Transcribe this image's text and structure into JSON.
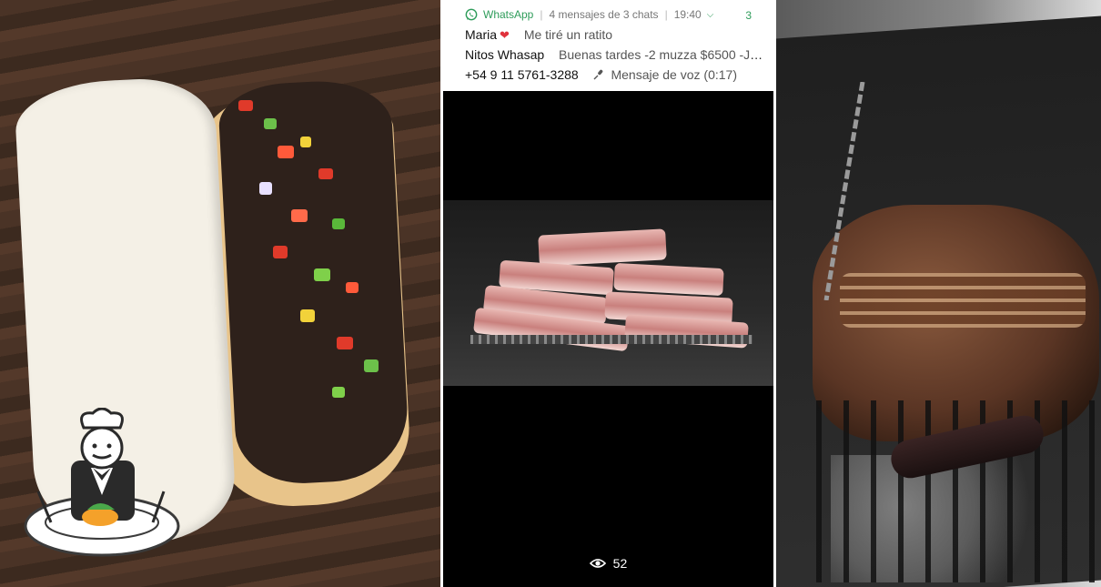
{
  "notification": {
    "app_name": "WhatsApp",
    "summary": "4 mensajes de 3 chats",
    "time": "19:40",
    "badge_count": "3",
    "messages": [
      {
        "sender": "Maria",
        "text": "Me tiré un ratito"
      },
      {
        "sender": "Nitos Whasap",
        "text": "Buenas tardes  -2 muzza $6500 -Jamo…"
      },
      {
        "sender": "+54 9 11 5761-3288",
        "text": "Mensaje de voz (0:17)"
      }
    ]
  },
  "status": {
    "view_count": "52"
  },
  "colors": {
    "whatsapp_green": "#2e9c5a",
    "heart_red": "#e0323c"
  },
  "icons": {
    "whatsapp": "whatsapp-icon",
    "heart": "heart-icon",
    "mic": "microphone-icon",
    "chevron": "chevron-down-icon",
    "eye": "eye-icon",
    "mascot": "restaurant-chef-icon"
  }
}
